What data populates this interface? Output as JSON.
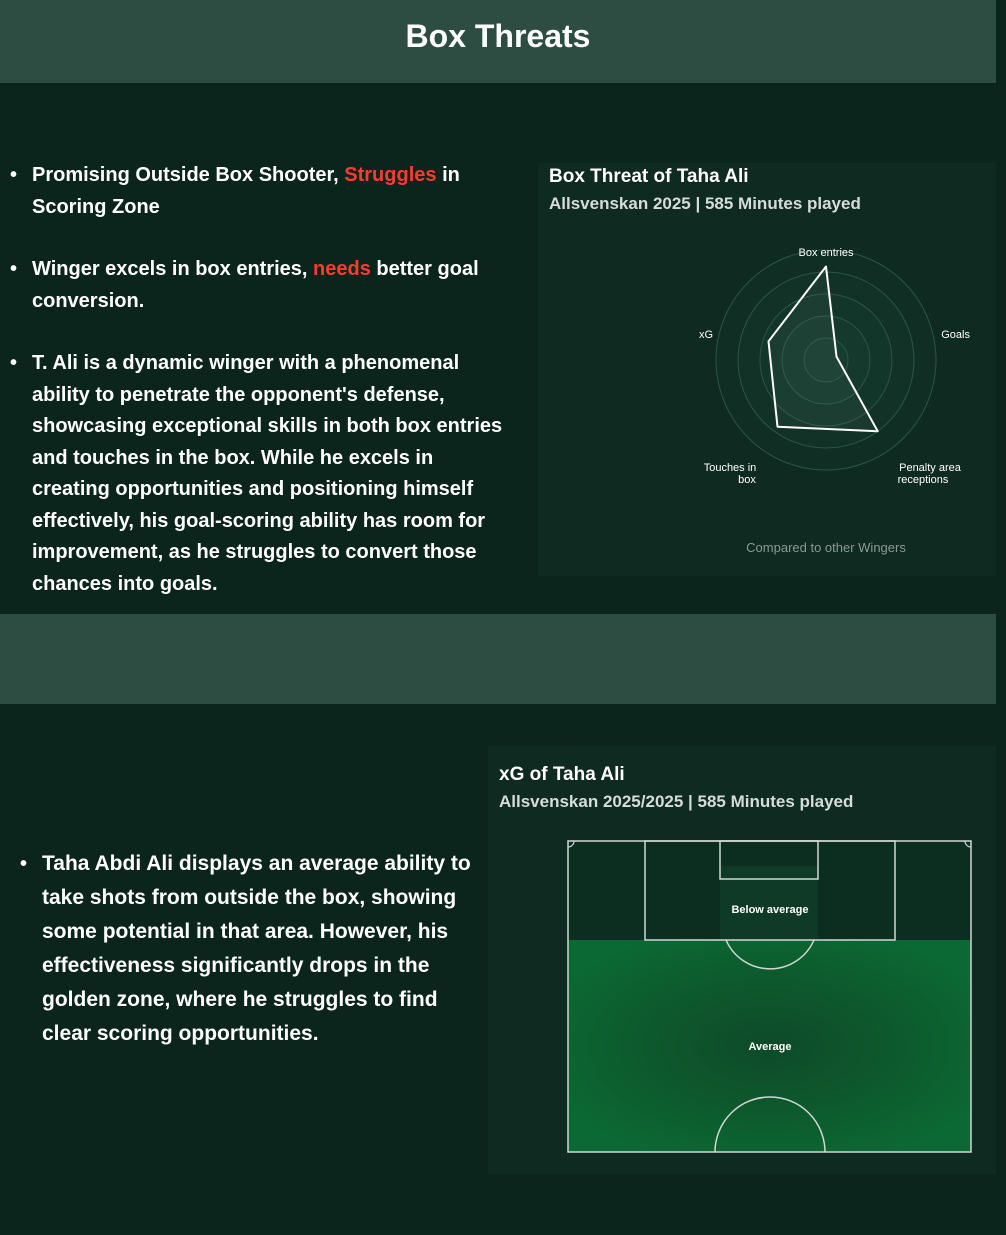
{
  "header": {
    "title": "Box Threats"
  },
  "upper_bullets": {
    "b1_pre": "Promising Outside Box Shooter, ",
    "b1_hl": "Struggles",
    "b1_post": " in Scoring Zone",
    "b2_pre": "Winger excels in box entries, ",
    "b2_hl": "needs",
    "b2_post": " better goal conversion.",
    "b3": "T. Ali is a dynamic winger with a phenomenal ability to penetrate the opponent's defense, showcasing exceptional skills in both box entries and touches in the box. While he excels in creating opportunities and positioning himself effectively, his goal-scoring ability has room for improvement, as he struggles to convert those chances into goals."
  },
  "radar_card": {
    "title": "Box Threat of Taha Ali",
    "subtitle": "Allsvenskan 2025 | 585 Minutes played",
    "labels": {
      "box_entries": "Box entries",
      "goals": "Goals",
      "penalty_line1": "Penalty area",
      "penalty_line2": "receptions",
      "touches_line1": "Touches in",
      "touches_line2": "box",
      "xg": "xG"
    },
    "footnote": "Compared to other Wingers"
  },
  "chart_data": {
    "type": "radar",
    "title": "Box Threat of Taha Ali",
    "subtitle": "Allsvenskan 2025 | 585 Minutes played",
    "axes": [
      "Box entries",
      "Goals",
      "Penalty area receptions",
      "Touches in box",
      "xG"
    ],
    "values": [
      0.85,
      0.1,
      0.8,
      0.75,
      0.55
    ],
    "range": [
      0,
      1
    ],
    "note": "Compared to other Wingers"
  },
  "pitch_card": {
    "title": "xG of Taha Ali",
    "subtitle": "Allsvenskan 2025/2025 | 585 Minutes played",
    "zones": {
      "inside_box": "Below average",
      "outside_box": "Average"
    }
  },
  "lower_bullets": {
    "b1": "Taha Abdi Ali displays an average ability to take shots from outside the box, showing some potential in that area. However, his effectiveness significantly drops in the golden zone, where he struggles to find clear scoring opportunities."
  },
  "colors": {
    "background": "#0b241c",
    "band": "#2d4d42",
    "highlight": "#ff3b30",
    "pitch_green": "#0c5a2c",
    "box_dark": "#0c2e21"
  }
}
